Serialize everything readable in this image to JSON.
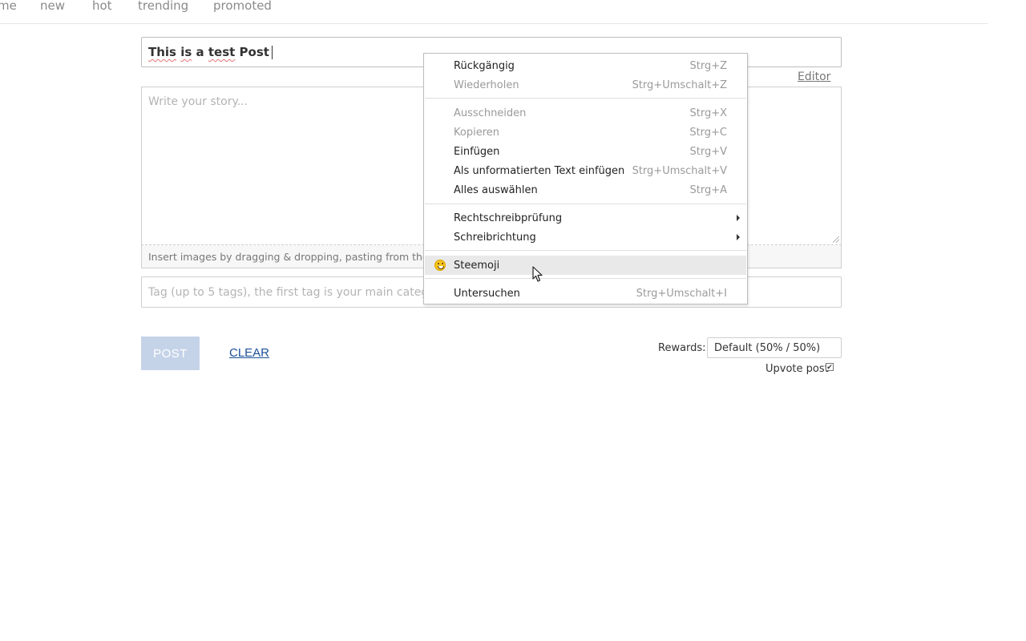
{
  "nav": {
    "items": [
      "me",
      "new",
      "hot",
      "trending",
      "promoted"
    ]
  },
  "editor": {
    "title_parts": [
      "This",
      " ",
      "is",
      " a ",
      "test",
      " Post"
    ],
    "editor_link": "Editor",
    "story_placeholder": "Write your story...",
    "insert_hint": "Insert images by dragging & dropping, pasting from the clip",
    "tag_placeholder": "Tag (up to 5 tags), the first tag is your main category."
  },
  "actions": {
    "post_label": "POST",
    "clear_label": "CLEAR",
    "rewards_label": "Rewards:",
    "rewards_value": "Default (50% / 50%)",
    "upvote_label": "Upvote post",
    "upvote_checked": true
  },
  "context_menu": {
    "groups": [
      [
        {
          "label": "Rückgängig",
          "shortcut": "Strg+Z",
          "disabled": false
        },
        {
          "label": "Wiederholen",
          "shortcut": "Strg+Umschalt+Z",
          "disabled": true
        }
      ],
      [
        {
          "label": "Ausschneiden",
          "shortcut": "Strg+X",
          "disabled": true
        },
        {
          "label": "Kopieren",
          "shortcut": "Strg+C",
          "disabled": true
        },
        {
          "label": "Einfügen",
          "shortcut": "Strg+V",
          "disabled": false
        },
        {
          "label": "Als unformatierten Text einfügen",
          "shortcut": "Strg+Umschalt+V",
          "disabled": false
        },
        {
          "label": "Alles auswählen",
          "shortcut": "Strg+A",
          "disabled": false
        }
      ],
      [
        {
          "label": "Rechtschreibprüfung",
          "submenu": true
        },
        {
          "label": "Schreibrichtung",
          "submenu": true
        }
      ],
      [
        {
          "label": "Steemoji",
          "icon": "emoji-icon",
          "hovered": true
        }
      ],
      [
        {
          "label": "Untersuchen",
          "shortcut": "Strg+Umschalt+I",
          "disabled": false
        }
      ]
    ]
  }
}
